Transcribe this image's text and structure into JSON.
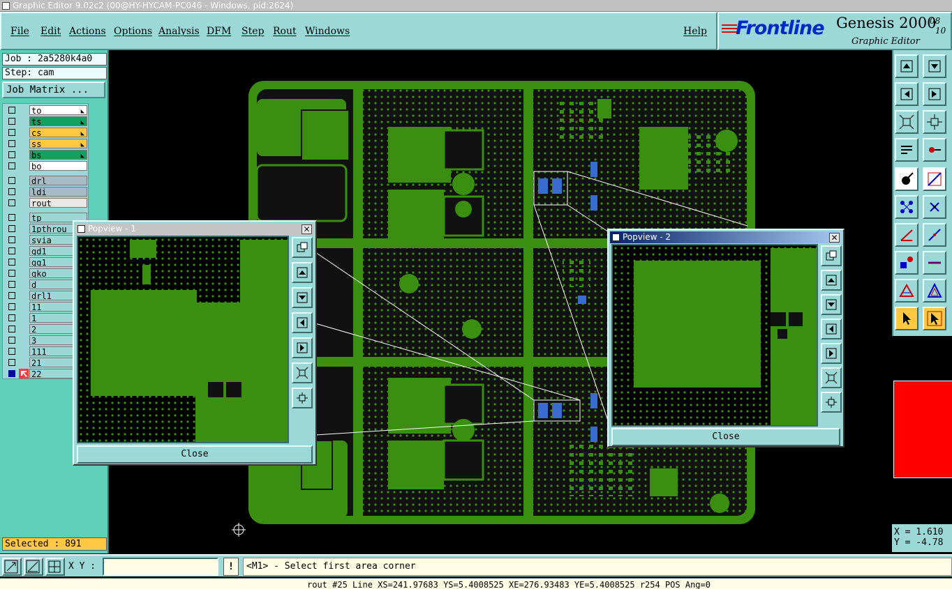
{
  "window": {
    "title": "Graphic Editor 9.02c2 (00@HY-HYCAM-PC046 - Windows, pid:2624)"
  },
  "menu": {
    "file": "File",
    "edit": "Edit",
    "actions": "Actions",
    "options": "Options",
    "analysis": "Analysis",
    "dfm": "DFM",
    "step": "Step",
    "rout": "Rout",
    "windows": "Windows",
    "help": "Help"
  },
  "brand": {
    "logo": "Frontline",
    "product": "Genesis 2000",
    "date_line1": "08",
    "date_line2": "10",
    "subtitle": "Graphic Editor"
  },
  "job": {
    "job_label": "Job : 2a5280k4a0",
    "step_label": "Step: cam",
    "matrix_button": "Job Matrix ..."
  },
  "layers": [
    {
      "name": "to",
      "color": "#ffffff",
      "arrow": true
    },
    {
      "name": "ts",
      "color": "#10a060",
      "arrow": true
    },
    {
      "name": "cs",
      "color": "#ffc840",
      "arrow": true
    },
    {
      "name": "ss",
      "color": "#ffc840",
      "arrow": true
    },
    {
      "name": "bs",
      "color": "#10a060",
      "arrow": true
    },
    {
      "name": "bo",
      "color": "#ffffff",
      "arrow": false
    },
    {
      "name": "drl",
      "color": "#a8bcc8",
      "arrow": false
    },
    {
      "name": "ldi",
      "color": "#a8bcc8",
      "arrow": false
    },
    {
      "name": "rout",
      "color": "#e8e8e8",
      "arrow": false
    },
    {
      "name": "tp",
      "color": "#9dd8d8",
      "arrow": false
    },
    {
      "name": "1pthrou",
      "color": "#9dd8d8",
      "arrow": false
    },
    {
      "name": "svia",
      "color": "#9dd8d8",
      "arrow": false
    },
    {
      "name": "gd1",
      "color": "#9dd8d8",
      "arrow": false
    },
    {
      "name": "gg1",
      "color": "#9dd8d8",
      "arrow": false
    },
    {
      "name": "gko",
      "color": "#9dd8d8",
      "arrow": false
    },
    {
      "name": "d",
      "color": "#9dd8d8",
      "arrow": false
    },
    {
      "name": "drl1",
      "color": "#9dd8d8",
      "arrow": false
    },
    {
      "name": "11",
      "color": "#9dd8d8",
      "arrow": false
    },
    {
      "name": "1",
      "color": "#9dd8d8",
      "arrow": false
    },
    {
      "name": "2",
      "color": "#9dd8d8",
      "arrow": false
    },
    {
      "name": "3",
      "color": "#9dd8d8",
      "arrow": false
    },
    {
      "name": "111",
      "color": "#9dd8d8",
      "arrow": false
    },
    {
      "name": "21",
      "color": "#9dd8d8",
      "arrow": false
    },
    {
      "name": "22",
      "color": "#9dd8d8",
      "arrow": false,
      "selected": true
    }
  ],
  "selected_count": "Selected : 891",
  "popview1": {
    "title": "Popview - 1",
    "close_x": "✕",
    "close_button": "Close"
  },
  "popview2": {
    "title": "Popview - 2",
    "close_x": "✕",
    "close_button": "Close"
  },
  "coords": {
    "x": "X = 1.610",
    "y": "Y = -4.78"
  },
  "bottom": {
    "xy_label": "X Y :",
    "xy_value": "",
    "excl": "!",
    "prompt": "<M1> - Select first area corner"
  },
  "status": "rout #25 Line XS=241.97683 YS=5.4008525 XE=276.93483 YE=5.4008525 r254 POS Ang=0",
  "colors": {
    "board": "#3a8e10",
    "accent": "#9dd8d8",
    "highlight": "#ffc840",
    "red": "#ff0000"
  }
}
